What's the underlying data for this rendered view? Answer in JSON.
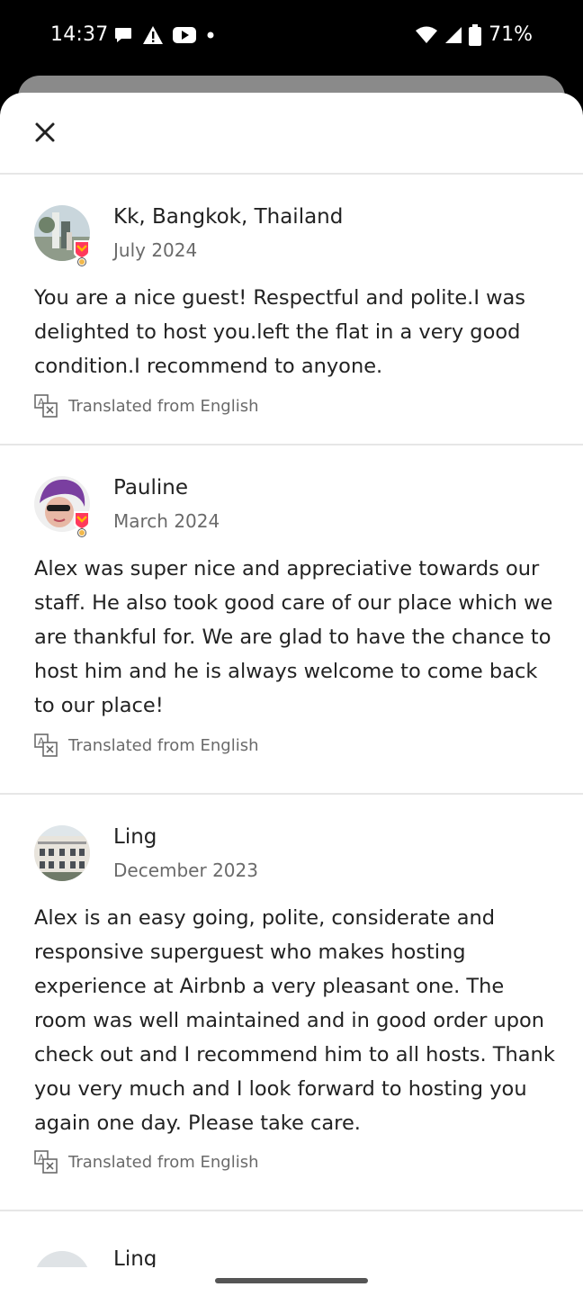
{
  "status_bar": {
    "time": "14:37",
    "battery": "71%",
    "icons_left": [
      "chat-bubble-icon",
      "warning-icon",
      "youtube-icon",
      "dot-icon"
    ],
    "icons_right": [
      "wifi-icon",
      "signal-icon",
      "battery-icon"
    ]
  },
  "sheet": {
    "close_icon": "close-icon"
  },
  "reviews": [
    {
      "name": "Kk, Bangkok, Thailand",
      "date": "July 2024",
      "text": "You are a nice guest!  Respectful and polite.I was delighted to host you.left the flat in a very good condition.I recommend to anyone.",
      "translated": "Translated from English",
      "superhost_badge": true
    },
    {
      "name": "Pauline",
      "date": "March 2024",
      "text": "Alex was super nice and appreciative towards our staff. He also took good care of our place which we are thankful for. We are glad to have the chance to host him and he is always welcome to come back to our place!",
      "translated": "Translated from English",
      "superhost_badge": true
    },
    {
      "name": "Ling",
      "date": "December 2023",
      "text": "Alex is an easy going, polite, considerate and responsive superguest who makes hosting experience at Airbnb a very pleasant one. The room was well maintained and in good order upon check out and I recommend him to all hosts. Thank you very much and I look forward to hosting you again one day. Please take care.",
      "translated": "Translated from English",
      "superhost_badge": false
    },
    {
      "name": "Ling"
    }
  ],
  "colors": {
    "text_primary": "#222222",
    "text_secondary": "#6a6a6a",
    "divider": "#e6e6e6",
    "badge": "#ff385c"
  }
}
